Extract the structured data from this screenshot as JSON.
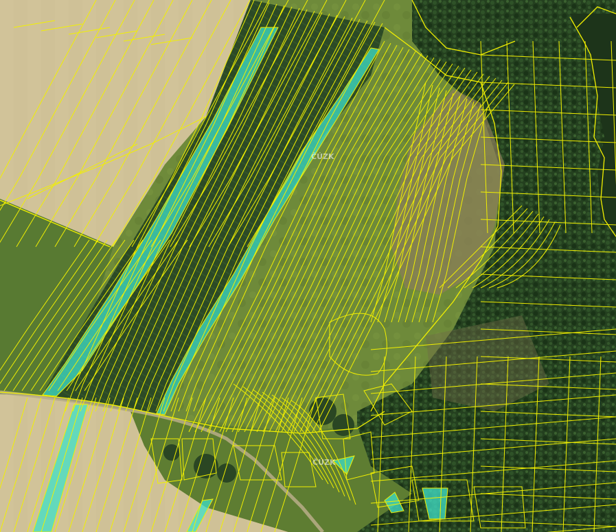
{
  "map": {
    "watermarks": [
      "ČÚZK",
      "ČÚZK"
    ],
    "colors": {
      "parcel_boundary": "#f2f000",
      "highlight_parcel": "#3fe0c8",
      "field_beige": "#cdbf93",
      "field_dark_green": "#2f4a24",
      "meadow_green": "#6f8c3c",
      "forest_dark": "#1f3a1c",
      "forest_mid": "#3a5a2a"
    },
    "layers": [
      "orthophoto",
      "cadastral-parcels",
      "highlighted-parcels"
    ]
  }
}
